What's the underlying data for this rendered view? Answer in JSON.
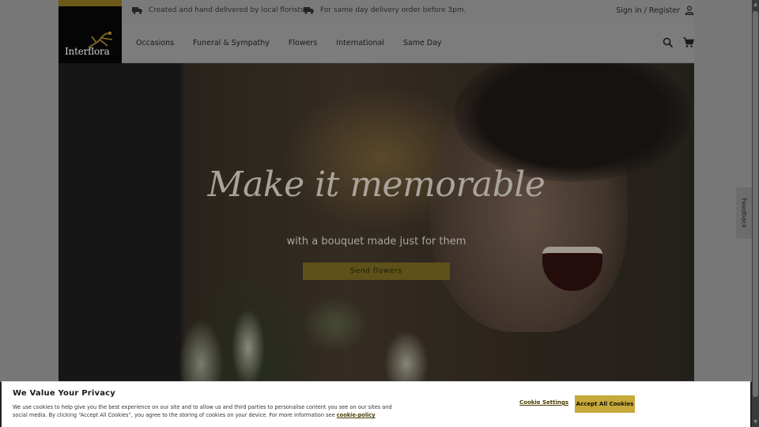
{
  "header": {
    "brand": "Interflora",
    "usps": [
      {
        "icon": "truck-icon",
        "text": "Created and hand delivered by local florists."
      },
      {
        "icon": "truck-icon",
        "text": "For same day delivery order before 3pm."
      }
    ],
    "signin_label": "Sign in / Register",
    "account_icon": "user-icon"
  },
  "nav": {
    "items": [
      "Occasions",
      "Funeral & Sympathy",
      "Flowers",
      "International",
      "Same Day"
    ],
    "search_icon": "search-icon",
    "cart_icon": "cart-icon"
  },
  "hero": {
    "title": "Make it memorable",
    "subtitle": "with a bouquet made just for them",
    "cta_label": "Send flowers"
  },
  "feedback": {
    "label": "Feedback"
  },
  "cookie_banner": {
    "title": "We Value Your Privacy",
    "text": "We use cookies to help give you the best experience on our site and to allow us and third parties to personalise content you see on our sites and social media. By clicking “Accept All Cookies”, you agree to the storing of cookies on your device. For more information see",
    "policy_link": "cookie-policy",
    "settings_label": "Cookie Settings",
    "accept_label": "Accept All Cookies"
  },
  "colors": {
    "brand_gold": "#c7a93a",
    "logo_bg": "#000000"
  }
}
